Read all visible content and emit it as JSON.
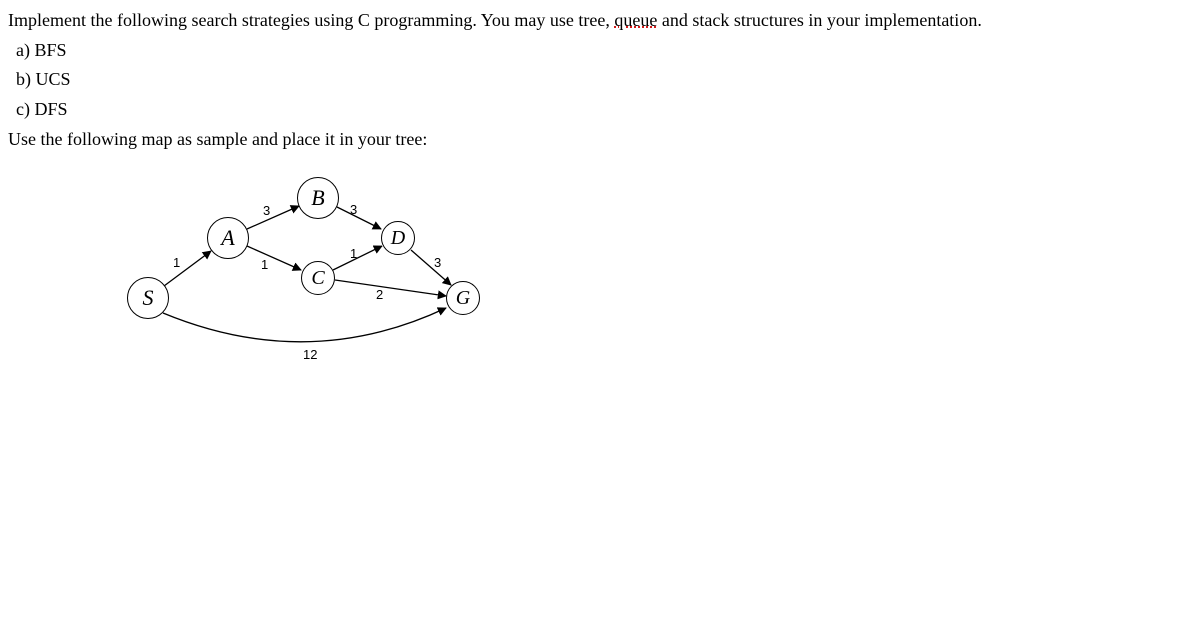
{
  "text": {
    "p1a": "Implement the following search strategies using C programming",
    "p1b": ". You may use tree, ",
    "p1c": "queue",
    "p1d": " and stack structures in your implementation.",
    "a": "a) BFS",
    "b": "b) UCS",
    "c": "c) DFS",
    "p2": "Use the following map as sample and place it in your tree:"
  },
  "graph": {
    "nodes": {
      "S": "S",
      "A": "A",
      "B": "B",
      "C": "C",
      "D": "D",
      "G": "G"
    },
    "weights": {
      "SA": "1",
      "AB": "3",
      "AC": "1",
      "BD": "3",
      "CD": "1",
      "CG": "2",
      "DG": "3",
      "SG": "12"
    }
  },
  "chart_data": {
    "type": "graph",
    "nodes": [
      "S",
      "A",
      "B",
      "C",
      "D",
      "G"
    ],
    "edges": [
      {
        "from": "S",
        "to": "A",
        "weight": 1
      },
      {
        "from": "A",
        "to": "B",
        "weight": 3
      },
      {
        "from": "A",
        "to": "C",
        "weight": 1
      },
      {
        "from": "B",
        "to": "D",
        "weight": 3
      },
      {
        "from": "C",
        "to": "D",
        "weight": 1
      },
      {
        "from": "C",
        "to": "G",
        "weight": 2
      },
      {
        "from": "D",
        "to": "G",
        "weight": 3
      },
      {
        "from": "S",
        "to": "G",
        "weight": 12
      }
    ],
    "start": "S",
    "goal": "G"
  }
}
